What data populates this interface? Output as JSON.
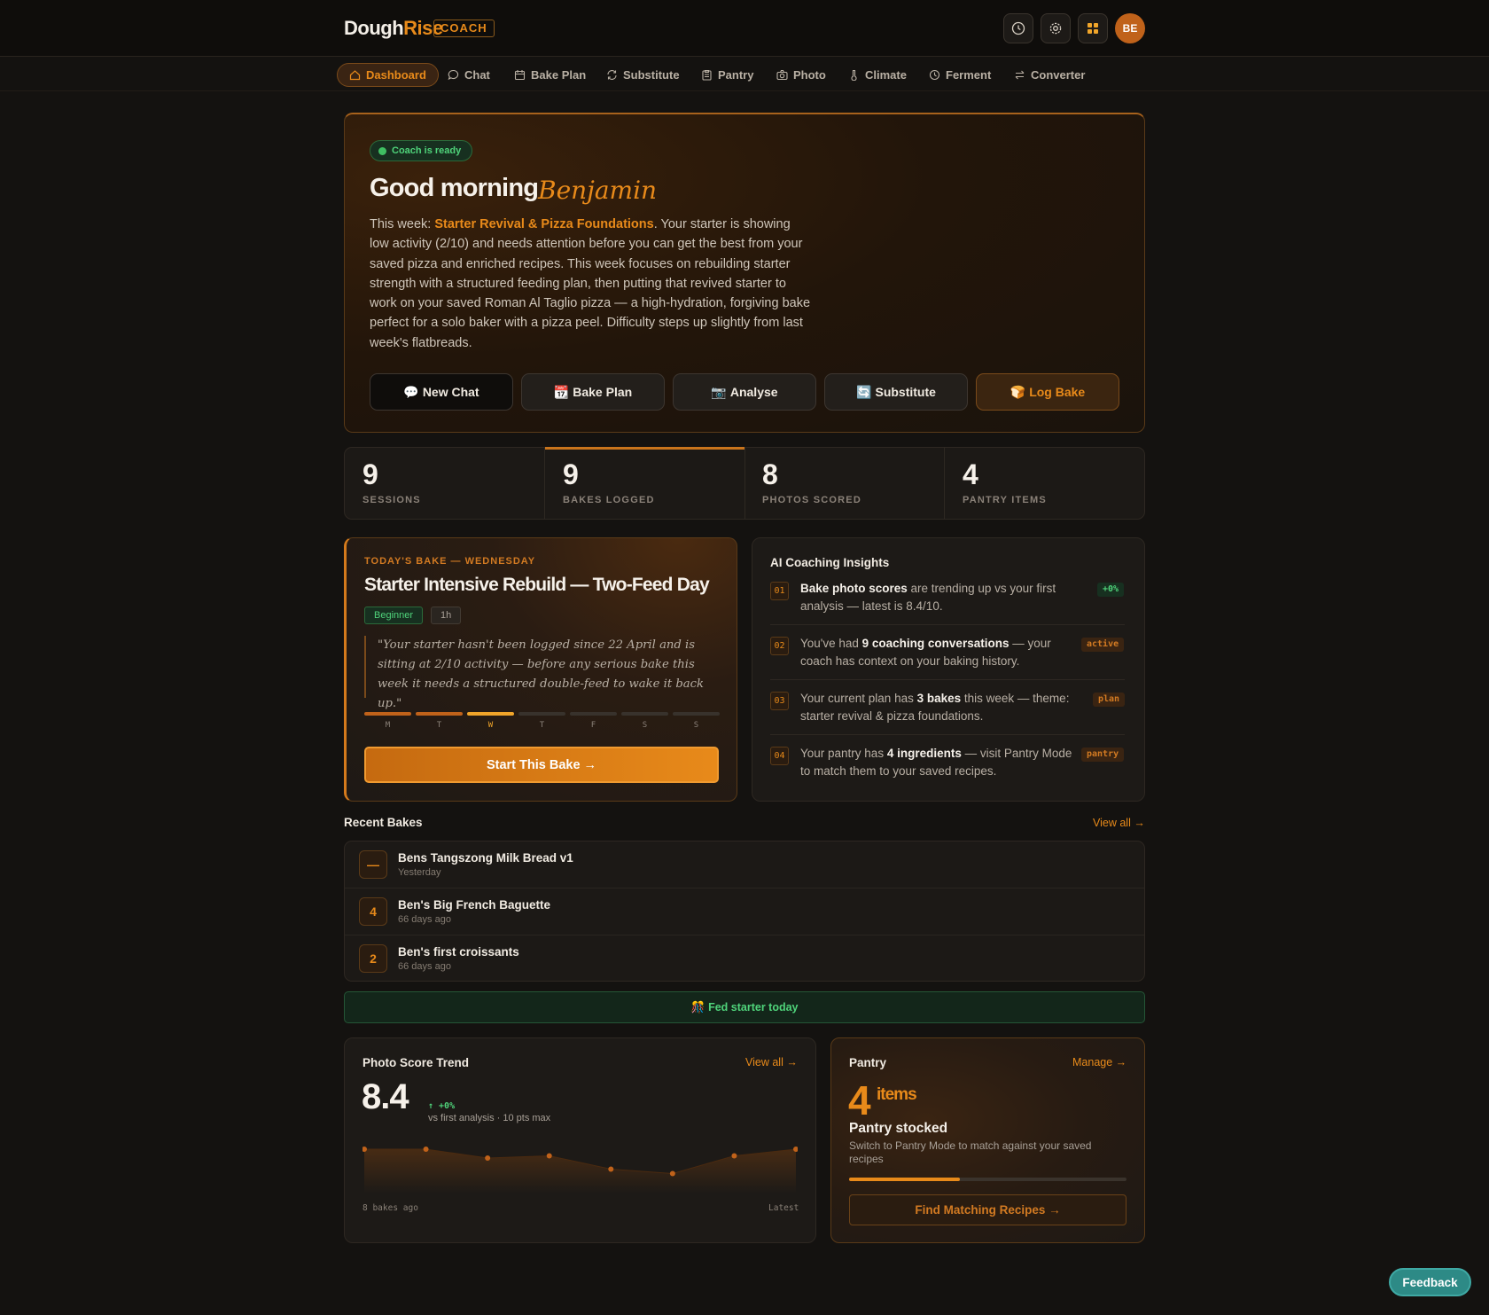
{
  "header": {
    "logo_part1": "Dough",
    "logo_part2": "Rise",
    "coach_tag": "COACH",
    "avatar_initials": "BE",
    "icons": [
      "clock-icon",
      "gear-icon",
      "grid-icon"
    ]
  },
  "nav": {
    "items": [
      {
        "label": "Dashboard",
        "icon": "home-icon",
        "active": true
      },
      {
        "label": "Chat",
        "icon": "chat-bubble-icon"
      },
      {
        "label": "Bake Plan",
        "icon": "calendar-icon"
      },
      {
        "label": "Substitute",
        "icon": "swap-circle-icon"
      },
      {
        "label": "Pantry",
        "icon": "clipboard-icon"
      },
      {
        "label": "Photo",
        "icon": "camera-icon"
      },
      {
        "label": "Climate",
        "icon": "thermometer-icon"
      },
      {
        "label": "Ferment",
        "icon": "timer-icon"
      },
      {
        "label": "Converter",
        "icon": "arrows-icon"
      }
    ]
  },
  "hero": {
    "status": "Coach is ready",
    "greeting": "Good morning",
    "name": "Benjamin",
    "intro_prefix": "This week: ",
    "theme": "Starter Revival & Pizza Foundations",
    "intro_body": ". Your starter is showing low activity (2/10) and needs attention before you can get the best from your saved pizza and enriched recipes. This week focuses on rebuilding starter strength with a structured feeding plan, then putting that revived starter to work on your saved Roman Al Taglio pizza — a high-hydration, forgiving bake perfect for a solo baker with a pizza peel. Difficulty steps up slightly from last week's flatbreads.",
    "buttons": [
      {
        "emoji": "💬",
        "label": "New Chat"
      },
      {
        "emoji": "📆",
        "label": "Bake Plan"
      },
      {
        "emoji": "📷",
        "label": "Analyse"
      },
      {
        "emoji": "🔄",
        "label": "Substitute"
      },
      {
        "emoji": "🍞",
        "label": "Log Bake"
      }
    ]
  },
  "stats": [
    {
      "value": "9",
      "label": "SESSIONS"
    },
    {
      "value": "9",
      "label": "BAKES LOGGED"
    },
    {
      "value": "8",
      "label": "PHOTOS SCORED"
    },
    {
      "value": "4",
      "label": "PANTRY ITEMS"
    }
  ],
  "today": {
    "tag": "TODAY'S BAKE — WEDNESDAY",
    "title": "Starter Intensive Rebuild — Two-Feed Day",
    "level": "Beginner",
    "duration": "1h",
    "quote": "\"Your starter hasn't been logged since 22 April and is sitting at 2/10 activity — before any serious bake this week it needs a structured double-feed to wake it back up.\"",
    "days": [
      {
        "label": "M",
        "state": "done"
      },
      {
        "label": "T",
        "state": "done"
      },
      {
        "label": "W",
        "state": "now"
      },
      {
        "label": "T",
        "state": "todo"
      },
      {
        "label": "F",
        "state": "todo"
      },
      {
        "label": "S",
        "state": "todo"
      },
      {
        "label": "S",
        "state": "todo"
      }
    ],
    "start_label": "Start This Bake →"
  },
  "insights": {
    "title": "AI Coaching Insights",
    "items": [
      {
        "num": "01",
        "bold": "Bake photo scores",
        "rest": " are trending up vs your first analysis — latest is 8.4/10.",
        "badge": "+0%",
        "badge_color": "#4fd37a"
      },
      {
        "num": "02",
        "pre": "You've had ",
        "bold": "9 coaching conversations",
        "rest": " — your coach has context on your baking history.",
        "badge": "active",
        "badge_color": "#d27a22"
      },
      {
        "num": "03",
        "pre": "Your current plan has ",
        "bold": "3 bakes",
        "rest": " this week — theme: starter revival & pizza foundations.",
        "badge": "plan",
        "badge_color": "#e88a1a"
      },
      {
        "num": "04",
        "pre": "Your pantry has ",
        "bold": "4 ingredients",
        "rest": " — visit Pantry Mode to match them to your saved recipes.",
        "badge": "pantry",
        "badge_color": "#d27a22"
      }
    ]
  },
  "recent": {
    "title": "Recent Bakes",
    "view_all": "View all →",
    "items": [
      {
        "score": "—",
        "name": "Bens Tangszong Milk Bread v1",
        "time": "Yesterday"
      },
      {
        "score": "4",
        "name": "Ben's Big French Baguette",
        "time": "66 days ago"
      },
      {
        "score": "2",
        "name": "Ben's first croissants",
        "time": "66 days ago"
      }
    ]
  },
  "fed": {
    "emoji": "🎊",
    "label": "Fed starter today"
  },
  "photo_trend": {
    "title": "Photo Score Trend",
    "view_all": "View all →",
    "score": "8.4",
    "delta": "↑ +0%",
    "sub": "vs first analysis · 10 pts max",
    "axis_left": "8 bakes ago",
    "axis_right": "Latest"
  },
  "chart_data": {
    "type": "area",
    "title": "Photo Score Trend",
    "x": [
      1,
      2,
      3,
      4,
      5,
      6,
      7,
      8
    ],
    "series": [
      {
        "values": [
          8.4,
          8.4,
          8.2,
          8.25,
          7.95,
          7.85,
          8.25,
          8.4
        ]
      }
    ],
    "ylim": [
      7.4,
      8.6
    ],
    "color": "#c0621a"
  },
  "pantry": {
    "title": "Pantry",
    "manage": "Manage →",
    "count": "4",
    "unit": "items",
    "headline": "Pantry stocked",
    "sub": "Switch to Pantry Mode to match against your saved recipes",
    "progress": 0.4,
    "button": "Find Matching Recipes →"
  },
  "feedback": "Feedback"
}
